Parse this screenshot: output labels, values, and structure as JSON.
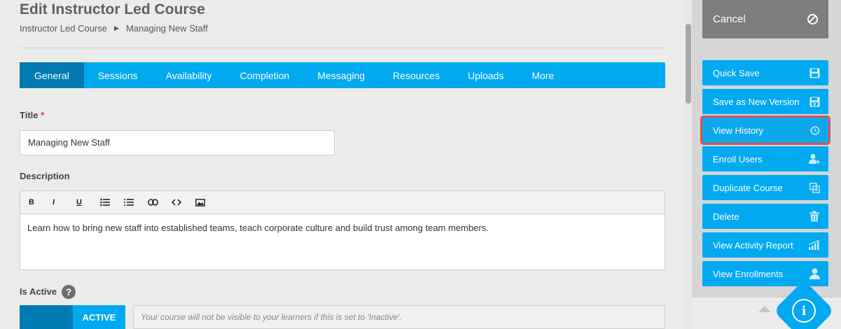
{
  "header": {
    "title": "Edit Instructor Led Course",
    "breadcrumb": [
      "Instructor Led Course",
      "Managing New Staff"
    ]
  },
  "tabs": [
    "General",
    "Sessions",
    "Availability",
    "Completion",
    "Messaging",
    "Resources",
    "Uploads",
    "More"
  ],
  "active_tab": "General",
  "form": {
    "title_label": "Title",
    "required_mark": "*",
    "title_value": "Managing New Staff",
    "description_label": "Description",
    "toolbar": {
      "bold": "B",
      "italic": "I",
      "underline": "U",
      "bullet_list": "☰",
      "numbered_list": "☰",
      "link": "⛓",
      "code": "<>",
      "image": "▣"
    },
    "description_value": "Learn how to bring new staff into established teams, teach corporate culture and build trust among  team members.",
    "is_active_label": "Is Active",
    "help_glyph": "?",
    "active_state": "ACTIVE",
    "active_hint": "Your course will not be visible to your learners if this is set to 'Inactive'."
  },
  "sidebar": {
    "cancel": "Cancel",
    "actions": [
      {
        "label": "Quick Save",
        "icon": "save-icon"
      },
      {
        "label": "Save as New Version",
        "icon": "save-version-icon"
      },
      {
        "label": "View History",
        "icon": "history-icon",
        "highlighted": true
      },
      {
        "label": "Enroll Users",
        "icon": "add-user-icon"
      },
      {
        "label": "Duplicate Course",
        "icon": "duplicate-icon"
      },
      {
        "label": "Delete",
        "icon": "trash-icon"
      },
      {
        "label": "View Activity Report",
        "icon": "bar-chart-icon"
      },
      {
        "label": "View Enrollments",
        "icon": "user-icon"
      }
    ],
    "info_glyph": "i"
  },
  "colors": {
    "accent": "#00a9f0",
    "accent_dark": "#007ab0",
    "cancel_bg": "#7d7d7d",
    "highlight": "#d9534f"
  }
}
